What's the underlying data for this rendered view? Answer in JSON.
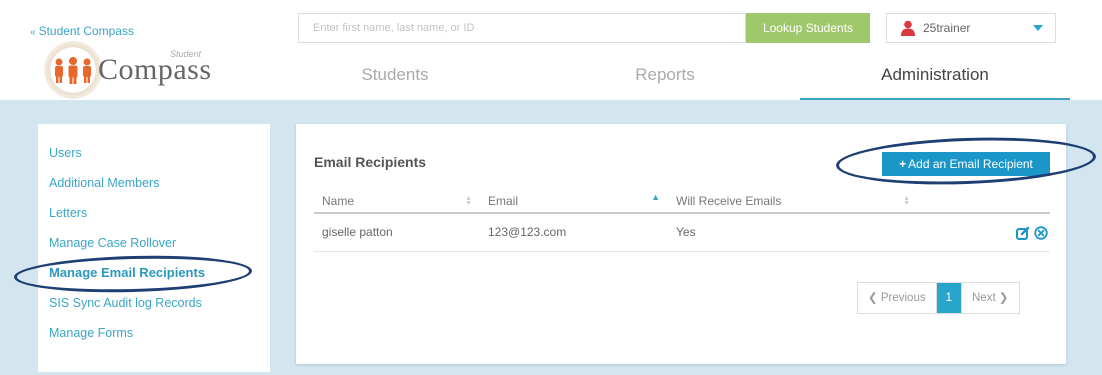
{
  "header": {
    "back_link": "Student Compass",
    "logo_small": "Student",
    "logo_big": "Compass",
    "search_placeholder": "Enter first name, last name, or ID",
    "lookup_label": "Lookup Students",
    "username": "25trainer"
  },
  "nav": {
    "tabs": [
      {
        "label": "Students"
      },
      {
        "label": "Reports"
      },
      {
        "label": "Administration"
      }
    ],
    "active": "Administration"
  },
  "sidebar": {
    "items": [
      {
        "label": "Users"
      },
      {
        "label": "Additional Members"
      },
      {
        "label": "Letters"
      },
      {
        "label": "Manage Case Rollover"
      },
      {
        "label": "Manage Email Recipients"
      },
      {
        "label": "SIS Sync Audit log Records"
      },
      {
        "label": "Manage Forms"
      }
    ],
    "active": "Manage Email Recipients"
  },
  "main": {
    "title": "Email Recipients",
    "add_button": "Add an Email Recipient",
    "columns": [
      "Name",
      "Email",
      "Will Receive Emails"
    ],
    "rows": [
      {
        "name": "giselle patton",
        "email": "123@123.com",
        "will_receive": "Yes"
      }
    ],
    "pager": {
      "previous": "Previous",
      "current": "1",
      "next": "Next"
    }
  },
  "colors": {
    "accent": "#29a5cc",
    "lookup_button": "#9fc86a",
    "band": "#d3e6ef",
    "annotation": "#1f3f74"
  }
}
